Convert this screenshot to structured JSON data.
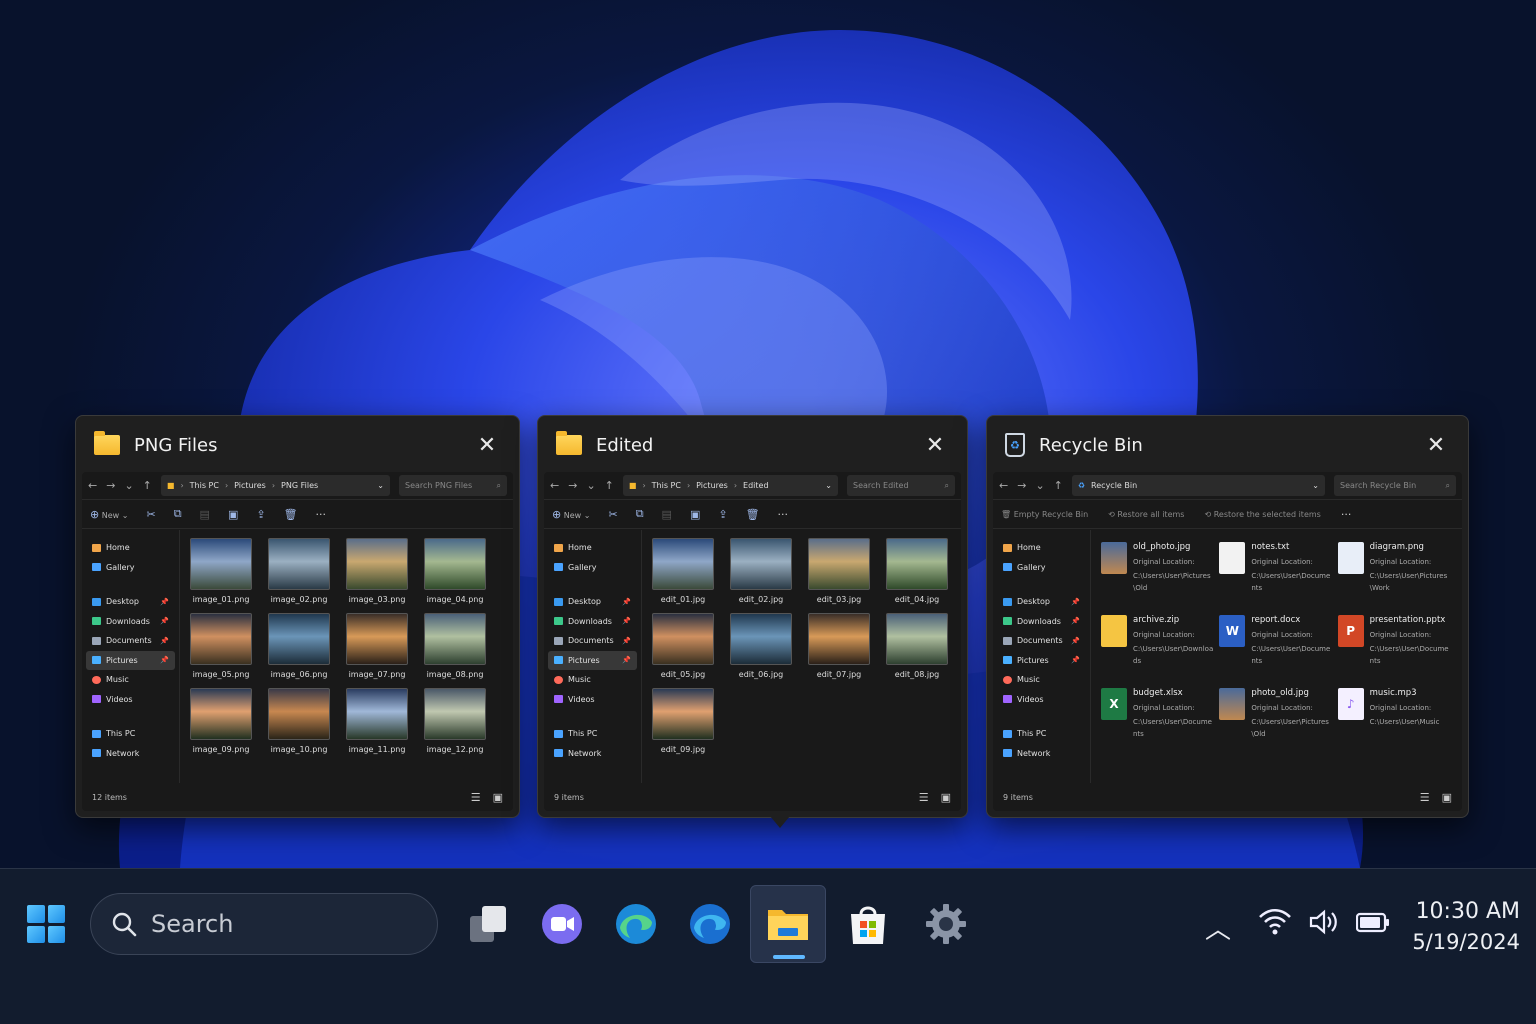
{
  "windows": {
    "png": {
      "title": "PNG Files",
      "path": [
        "This PC",
        "Pictures",
        "PNG Files"
      ],
      "search_placeholder": "Search PNG Files",
      "new_label": "New",
      "status": "12 items",
      "files": [
        "image_01.png",
        "image_02.png",
        "image_03.png",
        "image_04.png",
        "image_05.png",
        "image_06.png",
        "image_07.png",
        "image_08.png",
        "image_09.png",
        "image_10.png",
        "image_11.png",
        "image_12.png"
      ]
    },
    "edited": {
      "title": "Edited",
      "path": [
        "This PC",
        "Pictures",
        "Edited"
      ],
      "search_placeholder": "Search Edited",
      "new_label": "New",
      "status": "9 items",
      "files": [
        "edit_01.jpg",
        "edit_02.jpg",
        "edit_03.jpg",
        "edit_04.jpg",
        "edit_05.jpg",
        "edit_06.jpg",
        "edit_07.jpg",
        "edit_08.jpg",
        "edit_09.jpg"
      ]
    },
    "recycle": {
      "title": "Recycle Bin",
      "path": [
        "Recycle Bin"
      ],
      "search_placeholder": "Search Recycle Bin",
      "commands": [
        "Empty Recycle Bin",
        "Restore all items",
        "Restore the selected items"
      ],
      "status": "9 items",
      "location_label": "Original Location:",
      "items": [
        {
          "name": "old_photo.jpg",
          "location": "C:\\Users\\User\\Pictures\\Old",
          "icon": "photo-icon"
        },
        {
          "name": "notes.txt",
          "location": "C:\\Users\\User\\Documents",
          "icon": "text-file-icon"
        },
        {
          "name": "diagram.png",
          "location": "C:\\Users\\User\\Pictures\\Work",
          "icon": "image-file-icon"
        },
        {
          "name": "archive.zip",
          "location": "C:\\Users\\User\\Downloads",
          "icon": "zip-icon"
        },
        {
          "name": "report.docx",
          "location": "C:\\Users\\User\\Documents",
          "icon": "word-icon"
        },
        {
          "name": "presentation.pptx",
          "location": "C:\\Users\\User\\Documents",
          "icon": "powerpoint-icon"
        },
        {
          "name": "budget.xlsx",
          "location": "C:\\Users\\User\\Documents",
          "icon": "excel-icon"
        },
        {
          "name": "photo_old.jpg",
          "location": "C:\\Users\\User\\Pictures\\Old",
          "icon": "photo-icon"
        },
        {
          "name": "music.mp3",
          "location": "C:\\Users\\User\\Music",
          "icon": "music-file-icon"
        }
      ]
    }
  },
  "nav_pane": {
    "top": [
      "Home",
      "Gallery"
    ],
    "pinned": [
      "Desktop",
      "Downloads",
      "Documents",
      "Pictures",
      "Music",
      "Videos"
    ],
    "bottom": [
      "This PC",
      "Network"
    ],
    "selected": "Pictures"
  },
  "taskbar": {
    "search_label": "Search",
    "apps": [
      "task-view-icon",
      "teams-icon",
      "edge-icon",
      "edge-icon",
      "file-explorer-icon",
      "microsoft-store-icon",
      "settings-icon"
    ],
    "active_app": "file-explorer-icon"
  },
  "clock": {
    "time": "10:30 AM",
    "date": "5/19/2024"
  },
  "colors": {
    "accent": "#5fb8ff",
    "taskbar": "#121c2e",
    "window": "#1f1f1f",
    "folder": "#f5b82e"
  }
}
